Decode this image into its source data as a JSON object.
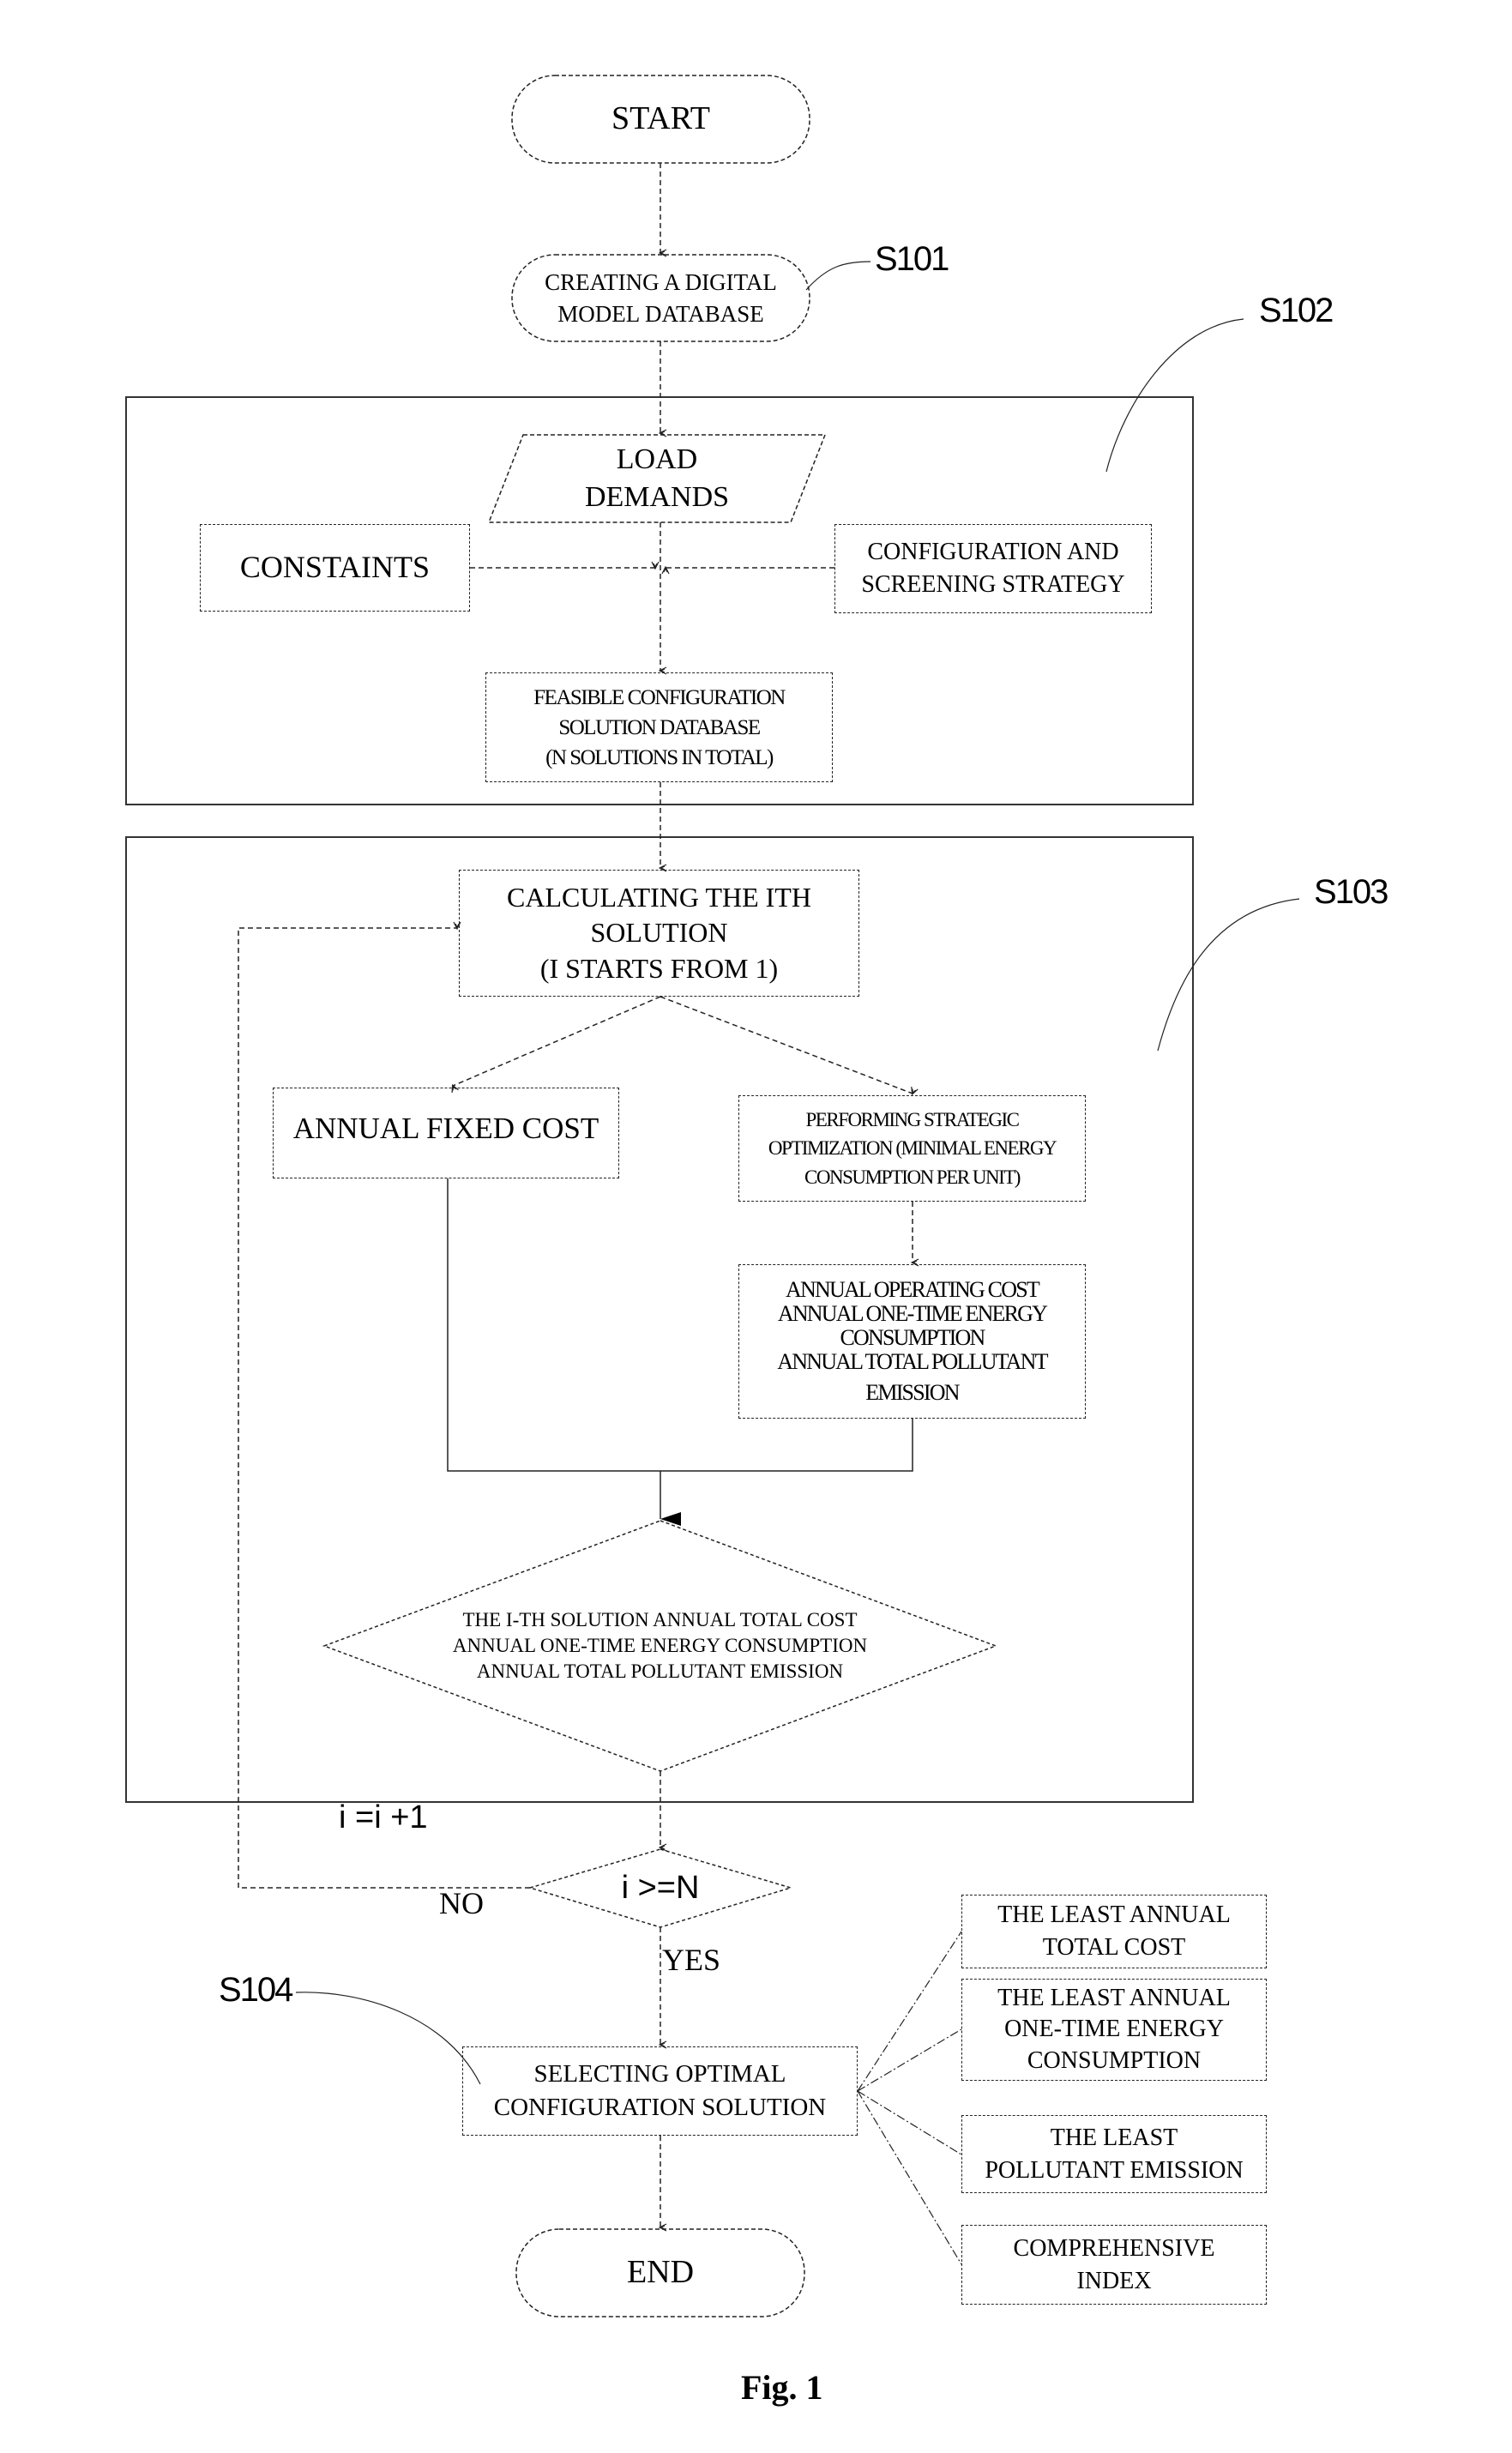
{
  "figure": {
    "caption": "Fig. 1",
    "step_labels": {
      "s101": "S101",
      "s102": "S102",
      "s103": "S103",
      "s104": "S104"
    },
    "nodes": {
      "start": "START",
      "create_db": [
        "CREATING A DIGITAL",
        "MODEL DATABASE"
      ],
      "load_demands": [
        "LOAD",
        "DEMANDS"
      ],
      "constraints": "CONSTAINTS",
      "config_strategy": [
        "CONFIGURATION AND",
        "SCREENING STRATEGY"
      ],
      "feasible_db": [
        "FEASIBLE CONFIGURATION",
        "SOLUTION DATABASE",
        "(N SOLUTIONS IN TOTAL)"
      ],
      "calculating": [
        "CALCULATING THE ITH",
        "SOLUTION",
        "(I STARTS FROM 1)"
      ],
      "annual_fixed_cost": "ANNUAL FIXED COST",
      "strategic_opt": [
        "PERFORMING STRATEGIC",
        "OPTIMIZATION (MINIMAL ENERGY",
        "CONSUMPTION PER UNIT)"
      ],
      "operating_results": [
        "ANNUAL OPERATING COST",
        "ANNUAL ONE-TIME ENERGY",
        "CONSUMPTION",
        "ANNUAL TOTAL POLLUTANT",
        "EMISSION"
      ],
      "ith_totals": [
        "THE I-TH SOLUTION ANNUAL TOTAL COST",
        "ANNUAL ONE-TIME ENERGY CONSUMPTION",
        "ANNUAL TOTAL POLLUTANT EMISSION"
      ],
      "loop_check": "i >=N",
      "increment": "i =i +1",
      "no_label": "NO",
      "yes_label": "YES",
      "select_optimal": [
        "SELECTING OPTIMAL",
        "CONFIGURATION SOLUTION"
      ],
      "end": "END",
      "criteria": [
        [
          "THE LEAST ANNUAL",
          "TOTAL COST"
        ],
        [
          "THE LEAST ANNUAL",
          "ONE-TIME ENERGY",
          "CONSUMPTION"
        ],
        [
          "THE LEAST",
          "POLLUTANT EMISSION"
        ],
        [
          "COMPREHENSIVE",
          "INDEX"
        ]
      ]
    }
  }
}
